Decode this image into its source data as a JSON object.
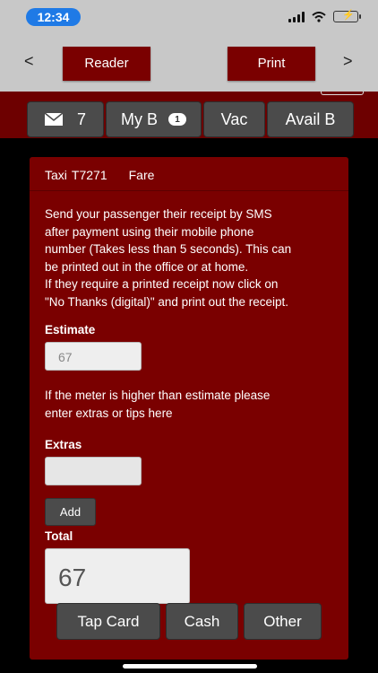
{
  "status": {
    "time": "12:34"
  },
  "nav": {
    "back": "<",
    "forward": ">",
    "reader_label": "Reader",
    "print_label": "Print"
  },
  "tabs": {
    "mail_count": "7",
    "myb_label": "My B",
    "myb_badge": "1",
    "vac_label": "Vac",
    "availb_label": "Avail B"
  },
  "panel": {
    "taxi_label": "Taxi",
    "taxi_id": "T7271",
    "fare_label": "Fare",
    "info_lines": [
      "Send your passenger their receipt by SMS",
      "after payment using their mobile phone",
      "number (Takes less than 5 seconds). This can",
      "be printed out in the office or at home.",
      "If they require a printed receipt now click on",
      "\"No Thanks (digital)\" and print out the receipt."
    ],
    "estimate_label": "Estimate",
    "estimate_value": "67",
    "hint_lines": [
      "If the meter is higher than estimate please",
      "enter extras or tips here"
    ],
    "extras_label": "Extras",
    "extras_value": "",
    "add_label": "Add",
    "total_label": "Total",
    "total_value": "67"
  },
  "payment": {
    "tap_card": "Tap Card",
    "cash": "Cash",
    "other": "Other"
  },
  "colors": {
    "dark_red": "#7a0000",
    "band_red": "#6d0000",
    "button_gray": "#4b4b4b",
    "bar_gray": "#c8c8c8"
  }
}
